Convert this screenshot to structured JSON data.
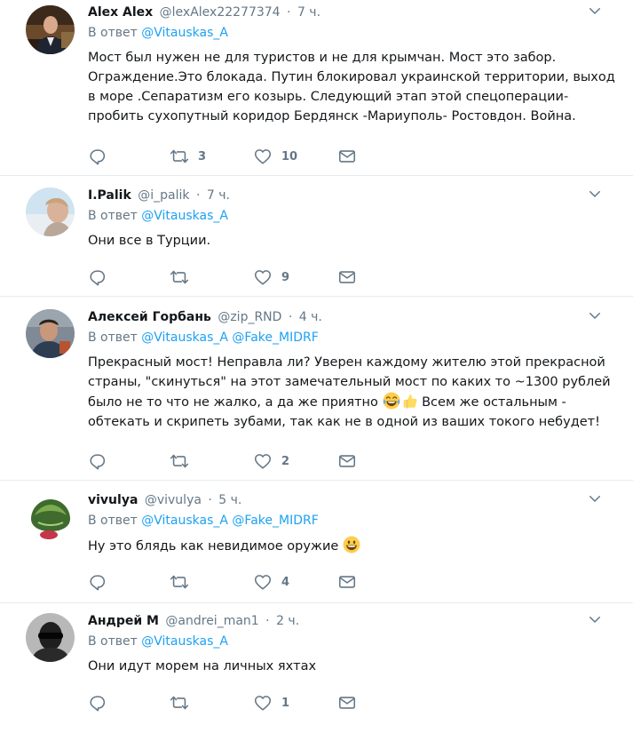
{
  "reply_prefix": "В ответ",
  "tweets": [
    {
      "name": "Alex Alex",
      "handle": "@lexAlex22277374",
      "time": "7 ч.",
      "mentions": [
        "@Vitauskas_A"
      ],
      "text": "Мост был нужен не для туристов и не для крымчан. Мост это забор. Ограждение.Это блокада.  Путин блокировал украинской территории, выход в море .Сепаратизм его козырь. Следующий этап этой спецоперации- пробить сухопутный коридор Бердянск -Мариуполь- Ростовдон. Война.",
      "retweets": "3",
      "likes": "10"
    },
    {
      "name": "I.Palik",
      "handle": "@i_palik",
      "time": "7 ч.",
      "mentions": [
        "@Vitauskas_A"
      ],
      "text": "Они все в Турции.",
      "retweets": "",
      "likes": "9"
    },
    {
      "name": "Алексей Горбань",
      "handle": "@zip_RND",
      "time": "4 ч.",
      "mentions": [
        "@Vitauskas_A",
        "@Fake_MIDRF"
      ],
      "text_before_emoji": "Прекрасный мост! Неправла ли? Уверен каждому жителю этой прекрасной страны, \"скинуться\" на этот замечательный мост по каких то ~1300 рублей было не то что не жалко, а да же приятно ",
      "text_after_emoji": " Всем же остальным - обтекать и скрипеть зубами, так как не в одной из ваших токого небудет!",
      "retweets": "",
      "likes": "2"
    },
    {
      "name": "vivulya",
      "handle": "@vivulya",
      "time": "5 ч.",
      "mentions": [
        "@Vitauskas_A",
        "@Fake_MIDRF"
      ],
      "text": "Ну это блядь как невидимое оружие ",
      "retweets": "",
      "likes": "4"
    },
    {
      "name": "Андрей М",
      "handle": "@andrei_man1",
      "time": "2 ч.",
      "mentions": [
        "@Vitauskas_A"
      ],
      "text": "Они идут морем на личных яхтах",
      "retweets": "",
      "likes": "1"
    }
  ],
  "colors": {
    "text": "#14171a",
    "secondary": "#657786",
    "link": "#1da1f2",
    "divider": "#e6ecf0"
  }
}
